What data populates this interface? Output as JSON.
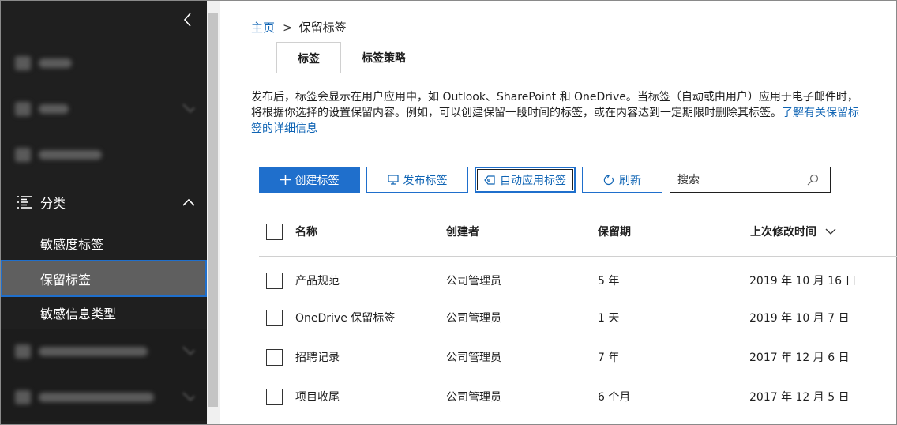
{
  "sidebar": {
    "classify_label": "分类",
    "sub_items": [
      {
        "label": "敏感度标签"
      },
      {
        "label": "保留标签"
      },
      {
        "label": "敏感信息类型"
      }
    ]
  },
  "breadcrumb": {
    "home": "主页",
    "separator": ">",
    "current": "保留标签"
  },
  "tabs": [
    {
      "label": "标签"
    },
    {
      "label": "标签策略"
    }
  ],
  "description": {
    "text": "发布后，标签会显示在用户应用中，如 Outlook、SharePoint 和 OneDrive。当标签（自动或由用户）应用于电子邮件时，将根据你选择的设置保留内容。例如，可以创建保留一段时间的标签，或在内容达到一定期限时删除其标签。",
    "link": "了解有关保留标签的详细信息"
  },
  "toolbar": {
    "create_label": "创建标签",
    "publish_label": "发布标签",
    "auto_label": "自动应用标签",
    "refresh_label": "刷新"
  },
  "search": {
    "placeholder": "搜索"
  },
  "table": {
    "headers": {
      "name": "名称",
      "creator": "创建者",
      "retention": "保留期",
      "modified": "上次修改时间"
    },
    "rows": [
      {
        "name": "产品规范",
        "creator": "公司管理员",
        "retention": "5 年",
        "modified": "2019 年 10 月 16 日"
      },
      {
        "name": "OneDrive 保留标签",
        "creator": "公司管理员",
        "retention": "1 天",
        "modified": "2019 年 10 月 7 日"
      },
      {
        "name": "招聘记录",
        "creator": "公司管理员",
        "retention": "7 年",
        "modified": "2017 年 12 月 6 日"
      },
      {
        "name": "项目收尾",
        "creator": "公司管理员",
        "retention": "6 个月",
        "modified": "2017 年 12 月 5 日"
      }
    ]
  },
  "colors": {
    "accent": "#1f6fcc",
    "link": "#0f64b4",
    "sidebar_bg": "#1f1f1f",
    "selected_bg": "#5f5f5f"
  }
}
